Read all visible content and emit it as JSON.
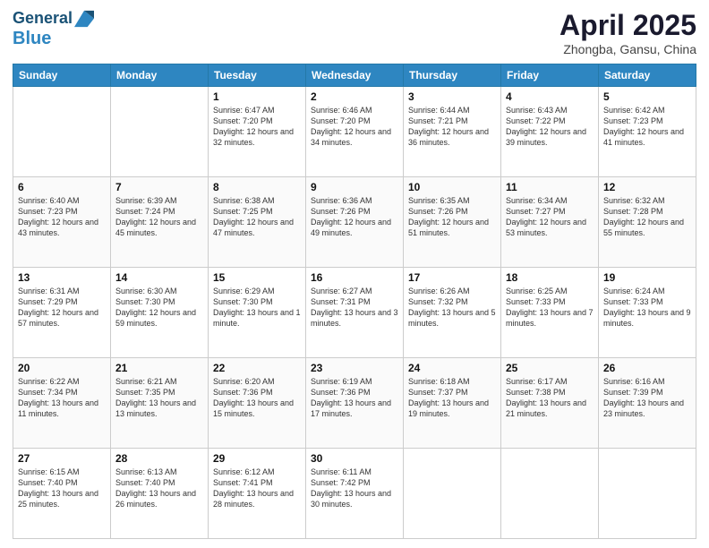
{
  "header": {
    "logo_line1": "General",
    "logo_line2": "Blue",
    "month_title": "April 2025",
    "subtitle": "Zhongba, Gansu, China"
  },
  "weekdays": [
    "Sunday",
    "Monday",
    "Tuesday",
    "Wednesday",
    "Thursday",
    "Friday",
    "Saturday"
  ],
  "weeks": [
    [
      {
        "day": "",
        "info": ""
      },
      {
        "day": "",
        "info": ""
      },
      {
        "day": "1",
        "info": "Sunrise: 6:47 AM\nSunset: 7:20 PM\nDaylight: 12 hours and 32 minutes."
      },
      {
        "day": "2",
        "info": "Sunrise: 6:46 AM\nSunset: 7:20 PM\nDaylight: 12 hours and 34 minutes."
      },
      {
        "day": "3",
        "info": "Sunrise: 6:44 AM\nSunset: 7:21 PM\nDaylight: 12 hours and 36 minutes."
      },
      {
        "day": "4",
        "info": "Sunrise: 6:43 AM\nSunset: 7:22 PM\nDaylight: 12 hours and 39 minutes."
      },
      {
        "day": "5",
        "info": "Sunrise: 6:42 AM\nSunset: 7:23 PM\nDaylight: 12 hours and 41 minutes."
      }
    ],
    [
      {
        "day": "6",
        "info": "Sunrise: 6:40 AM\nSunset: 7:23 PM\nDaylight: 12 hours and 43 minutes."
      },
      {
        "day": "7",
        "info": "Sunrise: 6:39 AM\nSunset: 7:24 PM\nDaylight: 12 hours and 45 minutes."
      },
      {
        "day": "8",
        "info": "Sunrise: 6:38 AM\nSunset: 7:25 PM\nDaylight: 12 hours and 47 minutes."
      },
      {
        "day": "9",
        "info": "Sunrise: 6:36 AM\nSunset: 7:26 PM\nDaylight: 12 hours and 49 minutes."
      },
      {
        "day": "10",
        "info": "Sunrise: 6:35 AM\nSunset: 7:26 PM\nDaylight: 12 hours and 51 minutes."
      },
      {
        "day": "11",
        "info": "Sunrise: 6:34 AM\nSunset: 7:27 PM\nDaylight: 12 hours and 53 minutes."
      },
      {
        "day": "12",
        "info": "Sunrise: 6:32 AM\nSunset: 7:28 PM\nDaylight: 12 hours and 55 minutes."
      }
    ],
    [
      {
        "day": "13",
        "info": "Sunrise: 6:31 AM\nSunset: 7:29 PM\nDaylight: 12 hours and 57 minutes."
      },
      {
        "day": "14",
        "info": "Sunrise: 6:30 AM\nSunset: 7:30 PM\nDaylight: 12 hours and 59 minutes."
      },
      {
        "day": "15",
        "info": "Sunrise: 6:29 AM\nSunset: 7:30 PM\nDaylight: 13 hours and 1 minute."
      },
      {
        "day": "16",
        "info": "Sunrise: 6:27 AM\nSunset: 7:31 PM\nDaylight: 13 hours and 3 minutes."
      },
      {
        "day": "17",
        "info": "Sunrise: 6:26 AM\nSunset: 7:32 PM\nDaylight: 13 hours and 5 minutes."
      },
      {
        "day": "18",
        "info": "Sunrise: 6:25 AM\nSunset: 7:33 PM\nDaylight: 13 hours and 7 minutes."
      },
      {
        "day": "19",
        "info": "Sunrise: 6:24 AM\nSunset: 7:33 PM\nDaylight: 13 hours and 9 minutes."
      }
    ],
    [
      {
        "day": "20",
        "info": "Sunrise: 6:22 AM\nSunset: 7:34 PM\nDaylight: 13 hours and 11 minutes."
      },
      {
        "day": "21",
        "info": "Sunrise: 6:21 AM\nSunset: 7:35 PM\nDaylight: 13 hours and 13 minutes."
      },
      {
        "day": "22",
        "info": "Sunrise: 6:20 AM\nSunset: 7:36 PM\nDaylight: 13 hours and 15 minutes."
      },
      {
        "day": "23",
        "info": "Sunrise: 6:19 AM\nSunset: 7:36 PM\nDaylight: 13 hours and 17 minutes."
      },
      {
        "day": "24",
        "info": "Sunrise: 6:18 AM\nSunset: 7:37 PM\nDaylight: 13 hours and 19 minutes."
      },
      {
        "day": "25",
        "info": "Sunrise: 6:17 AM\nSunset: 7:38 PM\nDaylight: 13 hours and 21 minutes."
      },
      {
        "day": "26",
        "info": "Sunrise: 6:16 AM\nSunset: 7:39 PM\nDaylight: 13 hours and 23 minutes."
      }
    ],
    [
      {
        "day": "27",
        "info": "Sunrise: 6:15 AM\nSunset: 7:40 PM\nDaylight: 13 hours and 25 minutes."
      },
      {
        "day": "28",
        "info": "Sunrise: 6:13 AM\nSunset: 7:40 PM\nDaylight: 13 hours and 26 minutes."
      },
      {
        "day": "29",
        "info": "Sunrise: 6:12 AM\nSunset: 7:41 PM\nDaylight: 13 hours and 28 minutes."
      },
      {
        "day": "30",
        "info": "Sunrise: 6:11 AM\nSunset: 7:42 PM\nDaylight: 13 hours and 30 minutes."
      },
      {
        "day": "",
        "info": ""
      },
      {
        "day": "",
        "info": ""
      },
      {
        "day": "",
        "info": ""
      }
    ]
  ]
}
